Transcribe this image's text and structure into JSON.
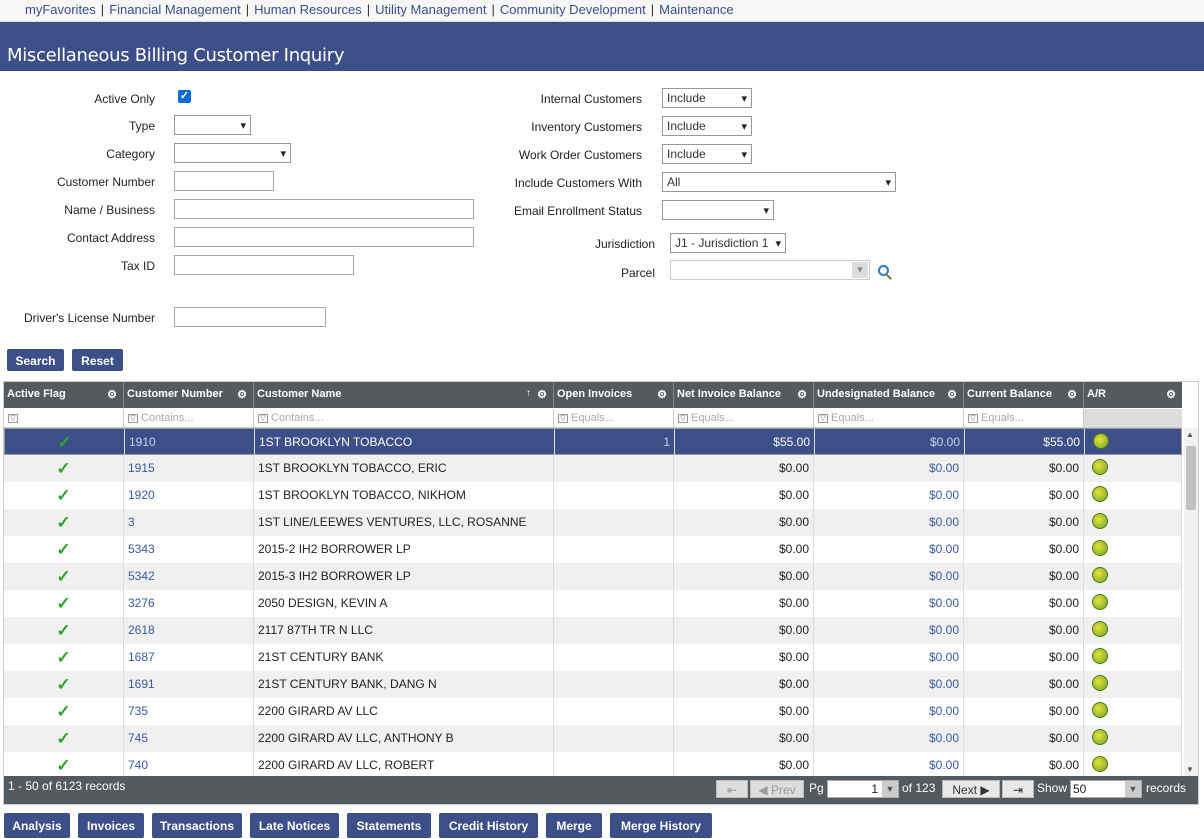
{
  "nav": [
    "myFavorites",
    "Financial Management",
    "Human Resources",
    "Utility Management",
    "Community Development",
    "Maintenance"
  ],
  "page_title": "Miscellaneous Billing Customer Inquiry",
  "form_left": {
    "active_only": "Active Only",
    "type": "Type",
    "category": "Category",
    "customer_number": "Customer Number",
    "name_business": "Name / Business",
    "contact_address": "Contact Address",
    "tax_id": "Tax ID",
    "drivers_license": "Driver's License Number"
  },
  "form_right": {
    "internal_customers": {
      "label": "Internal Customers",
      "value": "Include"
    },
    "inventory_customers": {
      "label": "Inventory Customers",
      "value": "Include"
    },
    "work_order_customers": {
      "label": "Work Order Customers",
      "value": "Include"
    },
    "include_customers_with": {
      "label": "Include Customers With",
      "value": "All"
    },
    "email_enrollment_status": {
      "label": "Email Enrollment Status",
      "value": ""
    },
    "jurisdiction": {
      "label": "Jurisdiction",
      "value": "J1 - Jurisdiction 1"
    },
    "parcel": {
      "label": "Parcel",
      "value": ""
    }
  },
  "actions": {
    "search": "Search",
    "reset": "Reset"
  },
  "grid": {
    "columns": [
      "Active Flag",
      "Customer Number",
      "Customer Name",
      "Open Invoices",
      "Net Invoice Balance",
      "Undesignated Balance",
      "Current Balance",
      "A/R"
    ],
    "filters": {
      "contains": "Contains...",
      "equals": "Equals..."
    },
    "rows": [
      {
        "number": "1910",
        "name": "1ST BROOKLYN TOBACCO",
        "open": "1",
        "net": "$55.00",
        "undesig": "$0.00",
        "current": "$55.00"
      },
      {
        "number": "1915",
        "name": "1ST BROOKLYN TOBACCO, ERIC",
        "open": "",
        "net": "$0.00",
        "undesig": "$0.00",
        "current": "$0.00"
      },
      {
        "number": "1920",
        "name": "1ST BROOKLYN TOBACCO, NIKHOM",
        "open": "",
        "net": "$0.00",
        "undesig": "$0.00",
        "current": "$0.00"
      },
      {
        "number": "3",
        "name": "1ST LINE/LEEWES VENTURES, LLC, ROSANNE",
        "open": "",
        "net": "$0.00",
        "undesig": "$0.00",
        "current": "$0.00"
      },
      {
        "number": "5343",
        "name": "2015-2 IH2 BORROWER LP",
        "open": "",
        "net": "$0.00",
        "undesig": "$0.00",
        "current": "$0.00"
      },
      {
        "number": "5342",
        "name": "2015-3 IH2 BORROWER LP",
        "open": "",
        "net": "$0.00",
        "undesig": "$0.00",
        "current": "$0.00"
      },
      {
        "number": "3276",
        "name": "2050 DESIGN, KEVIN A",
        "open": "",
        "net": "$0.00",
        "undesig": "$0.00",
        "current": "$0.00"
      },
      {
        "number": "2618",
        "name": "2117 87TH TR N LLC",
        "open": "",
        "net": "$0.00",
        "undesig": "$0.00",
        "current": "$0.00"
      },
      {
        "number": "1687",
        "name": "21ST CENTURY BANK",
        "open": "",
        "net": "$0.00",
        "undesig": "$0.00",
        "current": "$0.00"
      },
      {
        "number": "1691",
        "name": "21ST CENTURY BANK, DANG N",
        "open": "",
        "net": "$0.00",
        "undesig": "$0.00",
        "current": "$0.00"
      },
      {
        "number": "735",
        "name": "2200 GIRARD AV LLC",
        "open": "",
        "net": "$0.00",
        "undesig": "$0.00",
        "current": "$0.00"
      },
      {
        "number": "745",
        "name": "2200 GIRARD AV LLC, ANTHONY B",
        "open": "",
        "net": "$0.00",
        "undesig": "$0.00",
        "current": "$0.00"
      },
      {
        "number": "740",
        "name": "2200 GIRARD AV LLC, ROBERT",
        "open": "",
        "net": "$0.00",
        "undesig": "$0.00",
        "current": "$0.00"
      }
    ]
  },
  "pager": {
    "count": "1 - 50 of 6123 records",
    "prev": "Prev",
    "pg": "Pg",
    "page": "1",
    "of": "of 123",
    "next": "Next",
    "show": "Show",
    "page_size": "50",
    "records": "records"
  },
  "bottom_buttons": [
    "Analysis",
    "Invoices",
    "Transactions",
    "Late Notices",
    "Statements",
    "Credit History",
    "Merge",
    "Merge History"
  ]
}
